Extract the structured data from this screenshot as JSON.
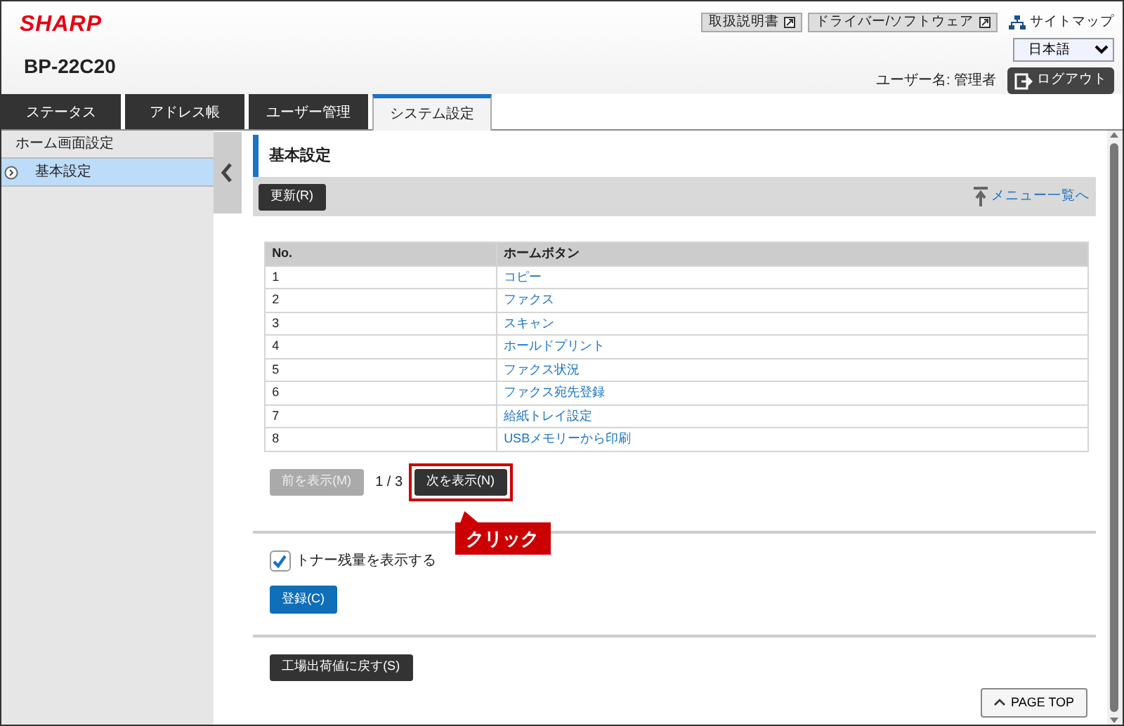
{
  "header": {
    "logo": "SHARP",
    "model": "BP-22C20",
    "links": [
      {
        "label": "取扱説明書",
        "kind": "external"
      },
      {
        "label": "ドライバー/ソフトウェア",
        "kind": "external"
      },
      {
        "label": "サイトマップ",
        "kind": "sitemap"
      }
    ],
    "language": "日本語",
    "user_label": "ユーザー名: 管理者",
    "logout": "ログアウト"
  },
  "tabs": [
    {
      "label": "ステータス",
      "selected": false
    },
    {
      "label": "アドレス帳",
      "selected": false
    },
    {
      "label": "ユーザー管理",
      "selected": false
    },
    {
      "label": "システム設定",
      "selected": true
    }
  ],
  "sidebar": {
    "items": [
      {
        "label": "ホーム画面設定",
        "selected": false
      },
      {
        "label": "基本設定",
        "selected": true
      }
    ]
  },
  "main": {
    "title": "基本設定",
    "update_button": "更新(R)",
    "menu_link": "メニュー一覧へ",
    "table": {
      "columns": [
        "No.",
        "ホームボタン"
      ],
      "rows": [
        [
          "1",
          "コピー"
        ],
        [
          "2",
          "ファクス"
        ],
        [
          "3",
          "スキャン"
        ],
        [
          "4",
          "ホールドプリント"
        ],
        [
          "5",
          "ファクス状況"
        ],
        [
          "6",
          "ファクス宛先登録"
        ],
        [
          "7",
          "給紙トレイ設定"
        ],
        [
          "8",
          "USBメモリーから印刷"
        ]
      ]
    },
    "pagination": {
      "prev": {
        "label": "前を表示(M)",
        "disabled": true
      },
      "page": "1 / 3",
      "next": {
        "label": "次を表示(N)",
        "disabled": false
      }
    },
    "callout": "クリック",
    "toner_checkbox": {
      "label": "トナー残量を表示する",
      "checked": true
    },
    "register_button": "登録(C)",
    "reset_button": "工場出荷値に戻す(S)",
    "page_top": "PAGE TOP"
  }
}
